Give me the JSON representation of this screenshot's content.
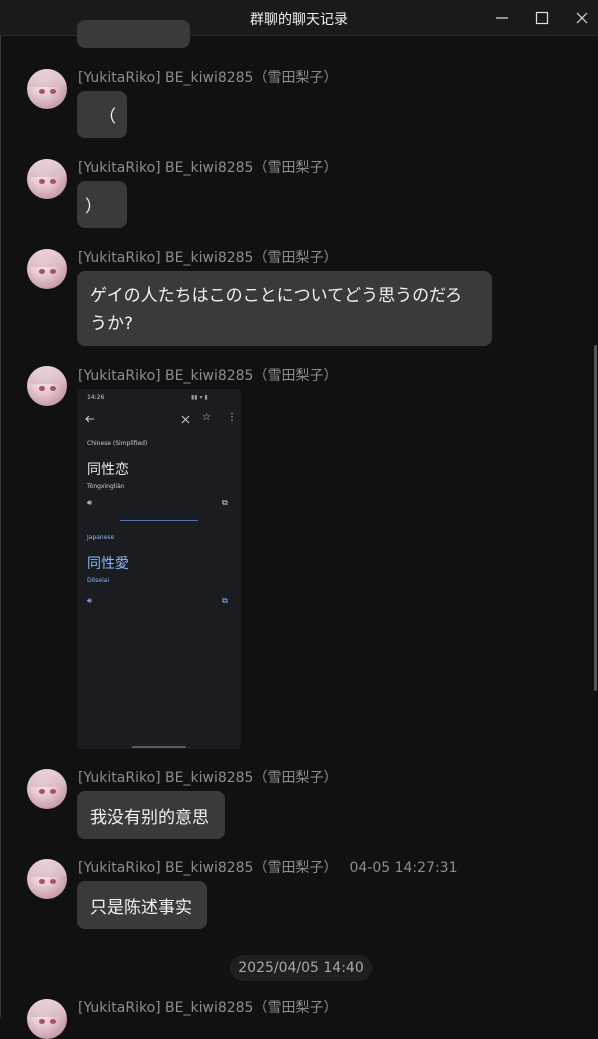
{
  "window": {
    "title": "群聊的聊天记录"
  },
  "sender_name": "[YukitaRiko] BE_kiwi8285（雪田梨子）",
  "messages": [
    {
      "text": "（"
    },
    {
      "text": "）"
    },
    {
      "text": "ゲイの人たちはこのことについてどう思うのだろ",
      "text2": "うか?"
    },
    {
      "image": "screenshot"
    },
    {
      "text": "我没有别的意思"
    },
    {
      "text": "只是陈述事实",
      "time": "04-05 14:27:31"
    }
  ],
  "date_separator": "2025/04/05 14:40",
  "screenshot": {
    "status_time": "14:26",
    "source_lang": "Chinese (Simplified)",
    "source_text": "同性恋",
    "source_pinyin": "Tóngxìngliàn",
    "target_lang": "Japanese",
    "target_text": "同性愛",
    "target_romaji": "Dōseiai"
  },
  "icons": [
    "minimize-icon",
    "maximize-icon",
    "close-icon",
    "back-arrow-icon",
    "star-icon",
    "more-icon",
    "speaker-icon",
    "copy-icon"
  ]
}
